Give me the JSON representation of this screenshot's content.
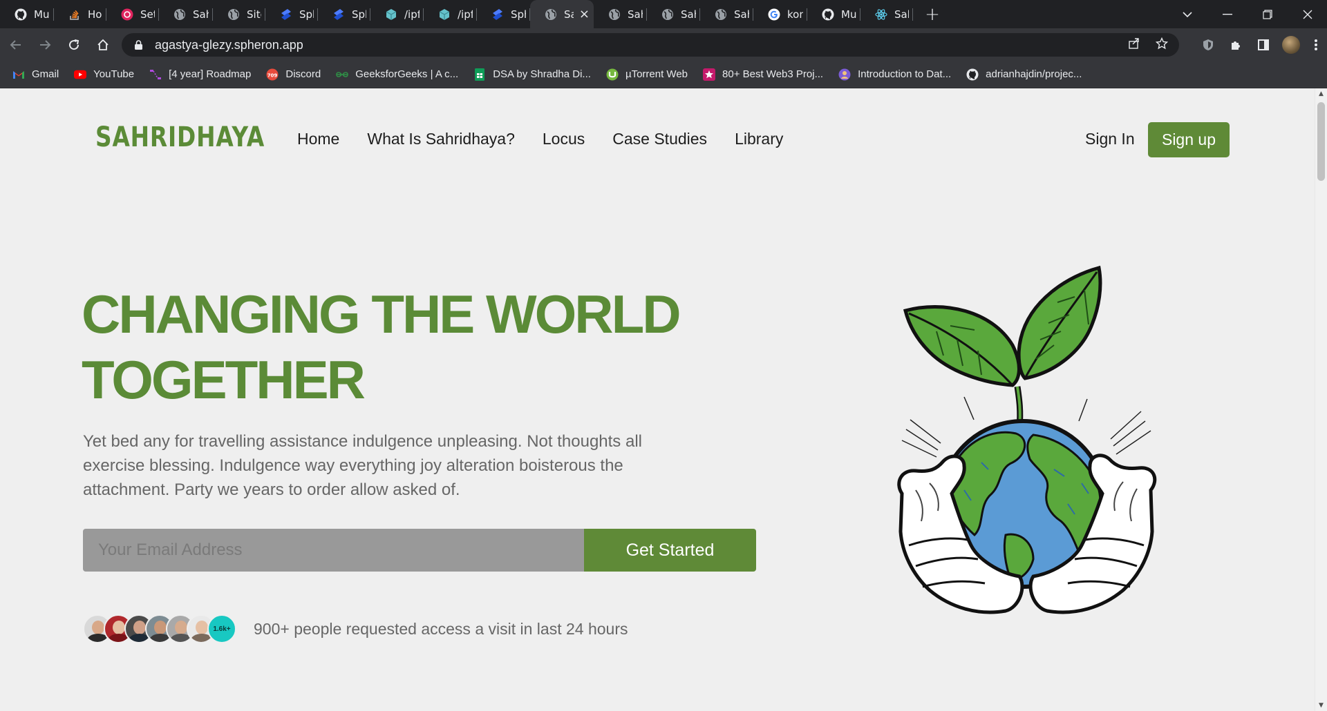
{
  "browser": {
    "tabs": [
      {
        "label": "Mukul",
        "icon": "github-icon"
      },
      {
        "label": "How t",
        "icon": "stackoverflow-icon"
      },
      {
        "label": "Set Up",
        "icon": "record-icon"
      },
      {
        "label": "Sahrid",
        "icon": "globe-icon"
      },
      {
        "label": "Site nc",
        "icon": "globe-icon"
      },
      {
        "label": "Sphere",
        "icon": "spheron-icon"
      },
      {
        "label": "Sphere",
        "icon": "spheron-icon"
      },
      {
        "label": "/ipfs/C",
        "icon": "ipfs-cube-icon"
      },
      {
        "label": "/ipfs/C",
        "icon": "ipfs-cube-icon"
      },
      {
        "label": "Sphere",
        "icon": "spheron-icon"
      },
      {
        "label": "Sal",
        "icon": "globe-icon",
        "active": true
      },
      {
        "label": "Sahrid",
        "icon": "globe-icon"
      },
      {
        "label": "Sahrid",
        "icon": "globe-icon"
      },
      {
        "label": "Sahrid",
        "icon": "globe-icon"
      },
      {
        "label": "komet",
        "icon": "google-icon"
      },
      {
        "label": "Mukul",
        "icon": "github-icon"
      },
      {
        "label": "Sahrid",
        "icon": "react-icon"
      }
    ],
    "url": "agastya-glezy.spheron.app",
    "bookmarks": [
      {
        "label": "Gmail",
        "icon": "gmail-icon"
      },
      {
        "label": "YouTube",
        "icon": "youtube-icon"
      },
      {
        "label": "[4 year] Roadmap",
        "icon": "roadmap-icon"
      },
      {
        "label": "Discord",
        "icon": "discord-icon"
      },
      {
        "label": "GeeksforGeeks | A c...",
        "icon": "geeksforgeeks-icon"
      },
      {
        "label": "DSA by Shradha Di...",
        "icon": "sheets-icon"
      },
      {
        "label": "µTorrent Web",
        "icon": "utorrent-icon"
      },
      {
        "label": "80+ Best Web3 Proj...",
        "icon": "web3-icon"
      },
      {
        "label": "Introduction to Dat...",
        "icon": "course-icon"
      },
      {
        "label": "adrianhajdin/projec...",
        "icon": "github-icon"
      }
    ]
  },
  "site": {
    "logo": "SAHRIDHAYA",
    "nav": [
      "Home",
      "What Is Sahridhaya?",
      "Locus",
      "Case Studies",
      "Library"
    ],
    "sign_in": "Sign In",
    "sign_up": "Sign up",
    "hero": {
      "title_line1": "CHANGING THE WORLD",
      "title_line2": "TOGETHER",
      "text": "Yet bed any for travelling assistance indulgence unpleasing. Not thoughts all exercise blessing. Indulgence way everything joy alteration boisterous the attachment. Party we years to order allow asked of.",
      "email_placeholder": "Your Email Address",
      "cta": "Get Started",
      "avatar_count": "1.6k+",
      "access_text": "900+ people requested access a visit in last 24 hours"
    }
  },
  "colors": {
    "brand_green": "#5f8a37",
    "teal_badge": "#18c8c2"
  }
}
